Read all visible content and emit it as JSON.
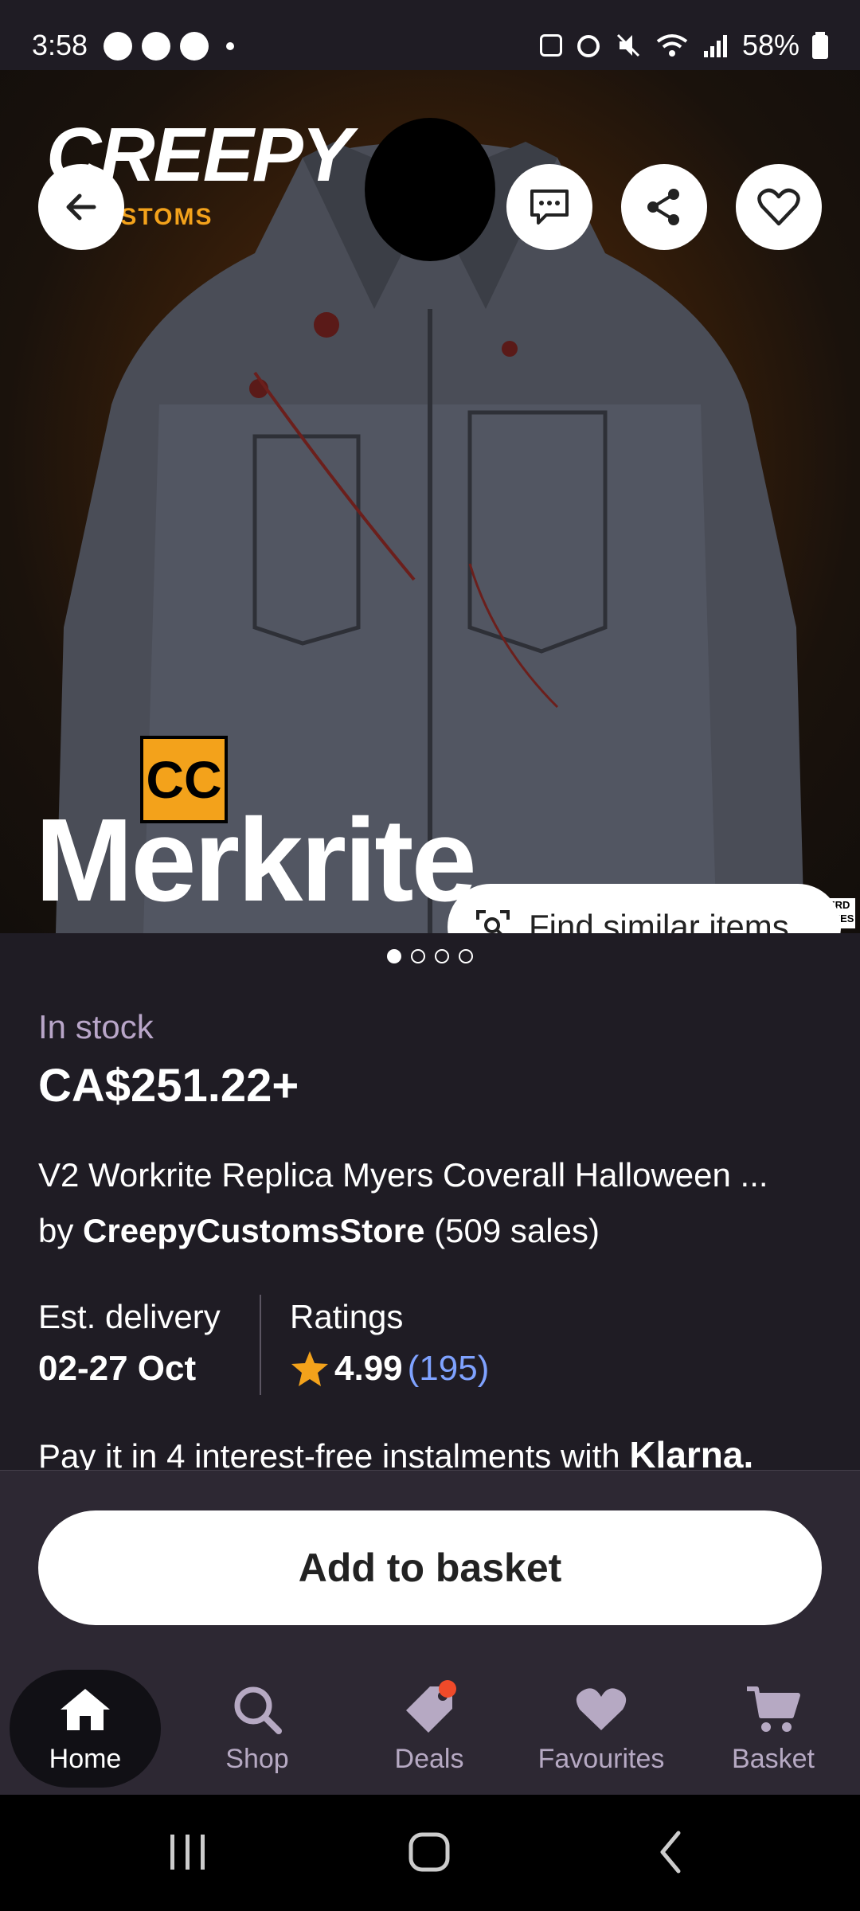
{
  "status_bar": {
    "time": "3:58",
    "battery": "58%"
  },
  "hero": {
    "brand_top": "CREEPY",
    "brand_sub": "CUSTOMS",
    "cc_logo": "CC",
    "overlay_word": "Merkrite",
    "watermark": "NERD MAKES",
    "find_similar_label": "Find similar items",
    "carousel": {
      "count": 4,
      "active": 1
    }
  },
  "product": {
    "stock_status": "In stock",
    "price": "CA$251.22+",
    "title": "V2 Workrite Replica Myers Coverall Halloween ...",
    "by_prefix": "by",
    "shop_name": "CreepyCustomsStore",
    "sales": "(509 sales)",
    "delivery_label": "Est. delivery",
    "delivery_value": "02-27 Oct",
    "ratings_label": "Ratings",
    "rating_value": "4.99",
    "rating_count": "(195)",
    "klarna_text": "Pay it in 4 interest-free instalments with",
    "klarna_brand": "Klarna."
  },
  "actions": {
    "add_to_basket": "Add to basket"
  },
  "bottom_nav": {
    "items": [
      {
        "label": "Home",
        "icon": "home-icon"
      },
      {
        "label": "Shop",
        "icon": "search-icon"
      },
      {
        "label": "Deals",
        "icon": "tag-icon"
      },
      {
        "label": "Favourites",
        "icon": "heart-icon"
      },
      {
        "label": "Basket",
        "icon": "cart-icon"
      }
    ]
  },
  "colors": {
    "background": "#1f1c24",
    "panel": "#2d2833",
    "stock": "#b9a6c9",
    "link": "#7fa2ff",
    "star": "#f3a21b",
    "badge": "#ef4a2a"
  }
}
